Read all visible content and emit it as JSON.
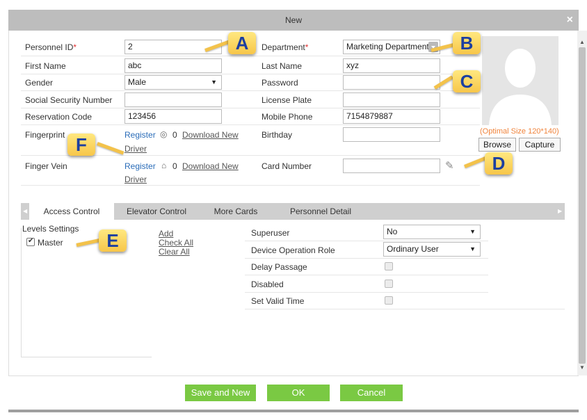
{
  "window": {
    "title": "New",
    "close_glyph": "×"
  },
  "form": {
    "personnel_id": {
      "label": "Personnel ID",
      "required": "*",
      "value": "2"
    },
    "department": {
      "label": "Department",
      "required": "*",
      "value": "Marketing Department"
    },
    "first_name": {
      "label": "First Name",
      "value": "abc"
    },
    "last_name": {
      "label": "Last Name",
      "value": "xyz"
    },
    "gender": {
      "label": "Gender",
      "value": "Male"
    },
    "password": {
      "label": "Password",
      "value": ""
    },
    "ssn": {
      "label": "Social Security Number",
      "value": ""
    },
    "license_plate": {
      "label": "License Plate",
      "value": ""
    },
    "reservation_code": {
      "label": "Reservation Code",
      "value": "123456"
    },
    "mobile_phone": {
      "label": "Mobile Phone",
      "value": "7154879887"
    },
    "fingerprint": {
      "label": "Fingerprint",
      "register": "Register",
      "count": "0",
      "download_1": "Download New",
      "download_2": "Driver"
    },
    "birthday": {
      "label": "Birthday",
      "value": ""
    },
    "finger_vein": {
      "label": "Finger Vein",
      "register": "Register",
      "count": "0",
      "download_1": "Download New",
      "download_2": "Driver"
    },
    "card_number": {
      "label": "Card Number",
      "value": ""
    }
  },
  "photo": {
    "optimal_size": "(Optimal Size 120*140)",
    "browse_label": "Browse",
    "capture_label": "Capture"
  },
  "tabs": [
    {
      "label": "Access Control",
      "active": true
    },
    {
      "label": "Elevator Control",
      "active": false
    },
    {
      "label": "More Cards",
      "active": false
    },
    {
      "label": "Personnel Detail",
      "active": false
    }
  ],
  "access": {
    "levels_title": "Levels Settings",
    "level_master": "Master",
    "add": "Add",
    "check_all": "Check All",
    "clear_all": "Clear All",
    "superuser": {
      "label": "Superuser",
      "value": "No"
    },
    "device_role": {
      "label": "Device Operation Role",
      "value": "Ordinary User"
    },
    "delay_passage": {
      "label": "Delay Passage"
    },
    "disabled": {
      "label": "Disabled"
    },
    "set_valid_time": {
      "label": "Set Valid Time"
    }
  },
  "footer": {
    "save_new": "Save and New",
    "ok": "OK",
    "cancel": "Cancel"
  },
  "callouts": {
    "a": "A",
    "b": "B",
    "c": "C",
    "d": "D",
    "e": "E",
    "f": "F"
  },
  "colors": {
    "accent_green": "#7ac943",
    "link_blue": "#2a6cb8",
    "required_red": "#e03030",
    "callout_yellow": "#f7c64a",
    "callout_text": "#1c3fa0"
  }
}
